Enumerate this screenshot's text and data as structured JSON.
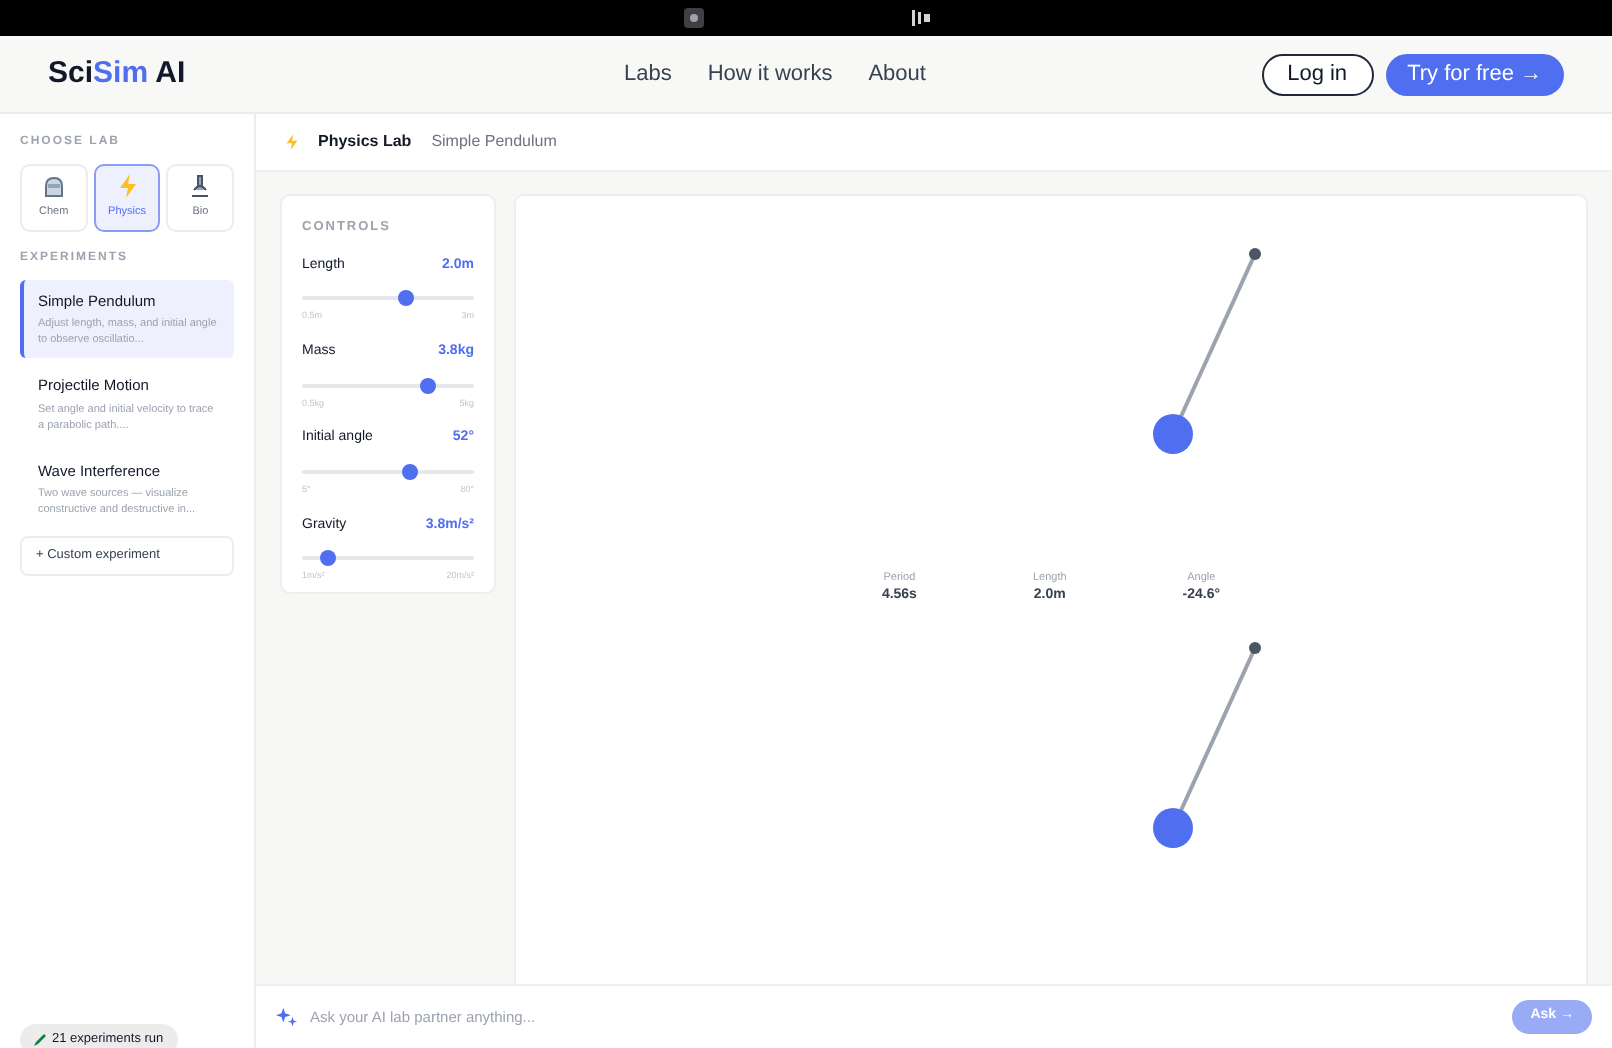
{
  "brand": {
    "part1": "Sci",
    "part2": "Sim",
    "part3": "AI"
  },
  "nav": [
    "Labs",
    "How it works",
    "About"
  ],
  "actions": {
    "login": "Log in",
    "try": "Try for free →"
  },
  "sidebar": {
    "choose_lab_title": "CHOOSE LAB",
    "labs": [
      {
        "kind": "flask",
        "label": "Chem",
        "selected": false
      },
      {
        "kind": "bolt",
        "label": "Physics",
        "selected": true
      },
      {
        "kind": "microscope",
        "label": "Bio",
        "selected": false
      }
    ],
    "experiments_title": "EXPERIMENTS",
    "experiments": [
      {
        "title": "Simple Pendulum",
        "description": "Adjust length, mass, and initial angle to observe oscillatio...",
        "selected": true
      },
      {
        "title": "Projectile Motion",
        "description": "Set angle and initial velocity to trace a parabolic path....",
        "selected": false
      },
      {
        "title": "Wave Interference",
        "description": "Two wave sources — visualize constructive and destructive in...",
        "selected": false
      }
    ],
    "custom_button_icon": "+",
    "custom_button": "Custom experiment",
    "footer_badge": "21 experiments run"
  },
  "breadcrumb": {
    "lab": "Physics Lab",
    "experiment": "Simple Pendulum"
  },
  "controls": {
    "title": "CONTROLS",
    "sliders": [
      {
        "label": "Length",
        "reading": "2.0m",
        "level": 0.6,
        "min": "0.5m",
        "max": "3m"
      },
      {
        "label": "Mass",
        "reading": "3.8kg",
        "level": 0.73,
        "min": "0.5kg",
        "max": "5kg"
      },
      {
        "label": "Initial angle",
        "reading": "52°",
        "level": 0.63,
        "min": "5°",
        "max": "80°"
      },
      {
        "label": "Gravity",
        "reading": "3.8m/s²",
        "level": 0.15,
        "min": "1m/s²",
        "max": "20m/s²"
      }
    ]
  },
  "simulation": {
    "panels": [
      {
        "kind": "pendulum",
        "stats": [
          {
            "label": "Period",
            "value": "4.56s"
          },
          {
            "label": "Length",
            "value": "2.0m"
          },
          {
            "label": "Angle",
            "value": "-24.6°"
          }
        ]
      },
      {
        "kind": "pendulum"
      }
    ]
  },
  "ask": {
    "placeholder": "Ask your AI lab partner anything...",
    "button": "Ask →"
  }
}
